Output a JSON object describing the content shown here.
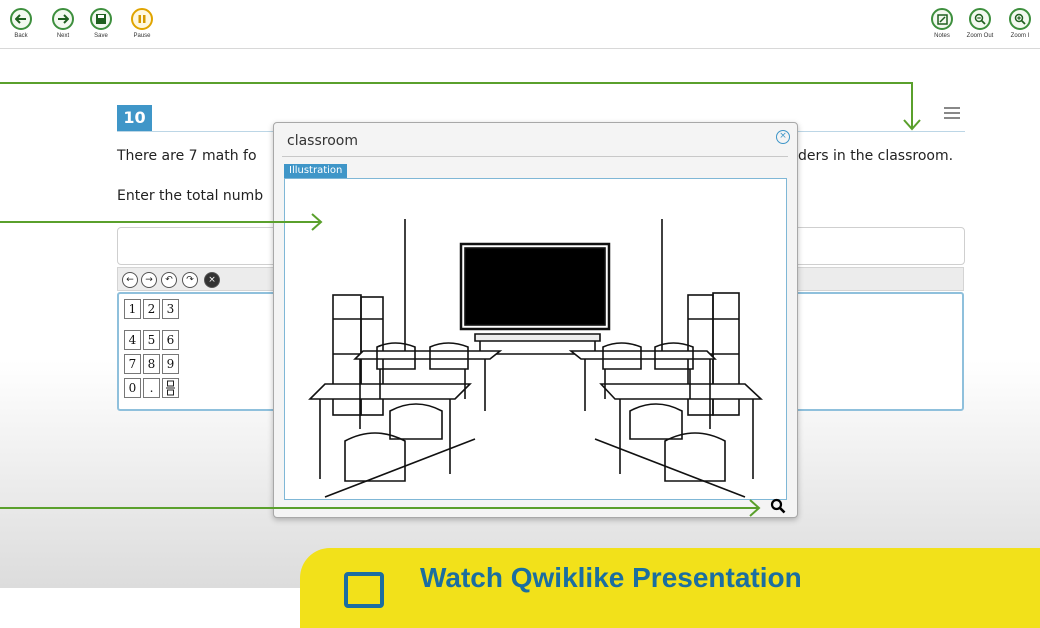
{
  "toolbar": {
    "left": [
      {
        "label": "Back",
        "icon": "back-arrow-icon"
      },
      {
        "label": "Next",
        "icon": "next-arrow-icon"
      },
      {
        "label": "Save",
        "icon": "save-disk-icon"
      },
      {
        "label": "Pause",
        "icon": "pause-icon"
      }
    ],
    "right": [
      {
        "label": "Notes",
        "icon": "notes-icon"
      },
      {
        "label": "Zoom Out",
        "icon": "zoom-out-icon"
      },
      {
        "label": "Zoom I",
        "icon": "zoom-in-icon"
      }
    ]
  },
  "question": {
    "number": "10",
    "line1_left": "There are 7 math fo",
    "line1_right": "ders in the classroom.",
    "line2_left": "Enter the total numb"
  },
  "keypad": {
    "keys": [
      "1",
      "2",
      "3",
      "4",
      "5",
      "6",
      "7",
      "8",
      "9",
      "0",
      "."
    ],
    "nav_buttons": [
      "left-arrow",
      "right-arrow",
      "undo",
      "redo",
      "delete"
    ]
  },
  "popup": {
    "title": "classroom",
    "tab_label": "Illustration"
  },
  "banner": {
    "text": "Watch Qwiklike Presentation"
  },
  "colors": {
    "accent_blue": "#3f96c8",
    "toolbar_green": "#3d8f3d",
    "pause_yellow": "#e0a400",
    "arrow_green": "#5aa02c",
    "banner_yellow": "#f2e11a",
    "banner_blue": "#1b6ea0"
  }
}
